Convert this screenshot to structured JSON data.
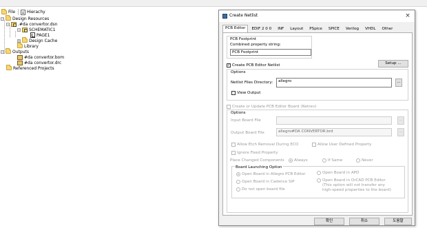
{
  "tree_tabs": [
    {
      "label": "File"
    },
    {
      "label": "Hierachy"
    }
  ],
  "tree": {
    "design_resources": "Design Resources",
    "dsn": ".#da convertor.dsn",
    "schematic": "SCHEMATIC1",
    "page": "PAGE1",
    "design_cache": "Design Cache",
    "library": "Library",
    "outputs": "Outputs",
    "bom": "#da convertor.bom",
    "drc": "#da convertor.drc",
    "referenced": "Referenced Projects"
  },
  "dialog": {
    "title": "Create Netlist",
    "close_glyph": "×",
    "tabs": [
      "PCB Editor",
      "EDIF 2 0 0",
      "INF",
      "Layout",
      "PSpice",
      "SPICE",
      "Verilog",
      "VHDL",
      "Other"
    ],
    "active_tab": "PCB Editor",
    "footprint": {
      "group_label": "PCB Footprint",
      "combined_label": "Combined property string:",
      "combined_value": "PCB Footprint"
    },
    "create_netlist": {
      "label": "Create PCB Editor Netlist",
      "checked": true,
      "setup_label": "Setup ..."
    },
    "options1": {
      "title": "Options",
      "dir_label": "Netlist Files Directory:",
      "dir_value": "allegro",
      "browse_label": "...",
      "view_output_label": "View Output"
    },
    "update_board": {
      "label": "Create or Update PCB Editor Board (Netrev)"
    },
    "options2": {
      "title": "Options",
      "input_board_label": "Input Board File",
      "input_board_value": "",
      "output_board_label": "Output Board File",
      "output_board_value": "allegro#DA CONVERTOR.brd",
      "browse_label": "...",
      "allow_etch_label": "Allow Etch Removal During ECO",
      "allow_user_label": "Allow User Defined Property",
      "ignore_fixed_label": "Ignore Fixed Property",
      "place_changed_label": "Place Changed Components",
      "place_options": [
        "Always",
        "If Same",
        "Never"
      ]
    },
    "board_launching": {
      "title": "Board Launching Option",
      "opt_allegro": "Open Board in Allegro PCB Editor",
      "opt_apd": "Open Board in APD",
      "opt_sip": "Open Board in Cadence SiP",
      "opt_orcad_l1": "Open Board in OrCAD PCB Editor",
      "opt_orcad_l2": "(This option will not transfer any",
      "opt_orcad_l3": "high-speed properties to the board)",
      "opt_donot": "Do not open board file"
    },
    "buttons": {
      "ok": "확인",
      "cancel": "취소",
      "help": "도움말"
    }
  }
}
